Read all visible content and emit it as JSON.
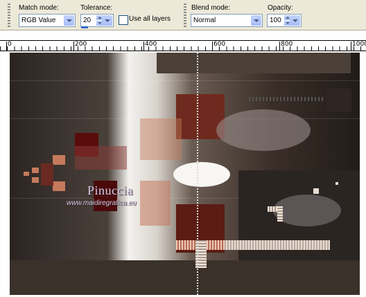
{
  "toolbar": {
    "match_mode": {
      "label": "Match mode:",
      "value": "RGB Value"
    },
    "tolerance": {
      "label": "Tolerance:",
      "value": "20"
    },
    "use_all_layers": {
      "label": "Use all layers",
      "checked": false
    },
    "blend_mode": {
      "label": "Blend mode:",
      "value": "Normal"
    },
    "opacity": {
      "label": "Opacity:",
      "value": "100"
    }
  },
  "ruler": {
    "marks": [
      "0",
      "200",
      "400",
      "600",
      "800",
      "1000"
    ]
  },
  "canvas": {
    "watermark_name": "Pinuccia",
    "watermark_url": "www.maidiregrafica.eu"
  },
  "colors": {
    "accent_dark_red": "#5a1410",
    "accent_salmon": "#c57a5c",
    "panel_bg": "#ece9d8",
    "field_border": "#7f9db9"
  },
  "icons": [
    "dropdown-arrow-icon",
    "spin-up-icon",
    "spin-down-icon",
    "toolbar-grip-icon"
  ]
}
